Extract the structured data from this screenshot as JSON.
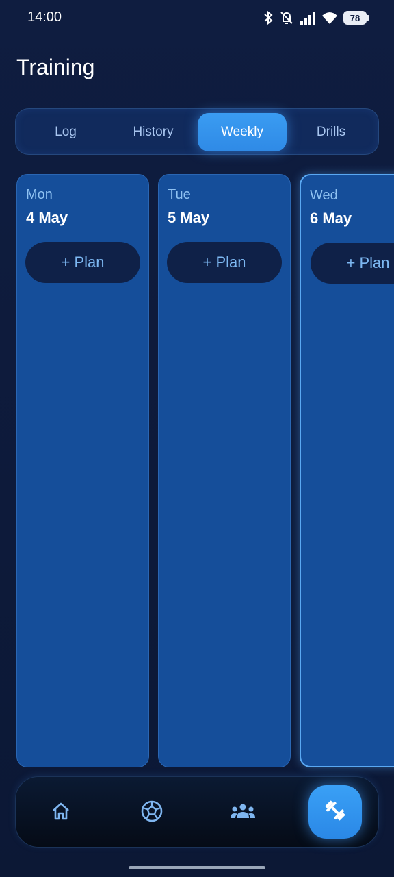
{
  "status_bar": {
    "time": "14:00",
    "battery": "78",
    "icons": [
      "bluetooth-icon",
      "mute-bell-icon",
      "signal-icon",
      "wifi-icon",
      "battery-icon"
    ]
  },
  "header": {
    "title": "Training"
  },
  "tabs": [
    {
      "label": "Log",
      "active": false
    },
    {
      "label": "History",
      "active": false
    },
    {
      "label": "Weekly",
      "active": true
    },
    {
      "label": "Drills",
      "active": false
    }
  ],
  "week": {
    "days": [
      {
        "day": "Mon",
        "date": "4 May",
        "plan_label": "+ Plan",
        "today": false
      },
      {
        "day": "Tue",
        "date": "5 May",
        "plan_label": "+ Plan",
        "today": false
      },
      {
        "day": "Wed",
        "date": "6 May",
        "plan_label": "+ Plan",
        "today": true
      }
    ]
  },
  "bottom_nav": {
    "items": [
      {
        "icon": "home-icon",
        "active": false
      },
      {
        "icon": "soccer-ball-icon",
        "active": false
      },
      {
        "icon": "team-icon",
        "active": false
      },
      {
        "icon": "dumbbell-icon",
        "active": true
      }
    ]
  },
  "colors": {
    "background": "#0e1c3e",
    "accent": "#3a9cf2",
    "card": "#154e9a",
    "muted_text": "#8fc2f2"
  }
}
